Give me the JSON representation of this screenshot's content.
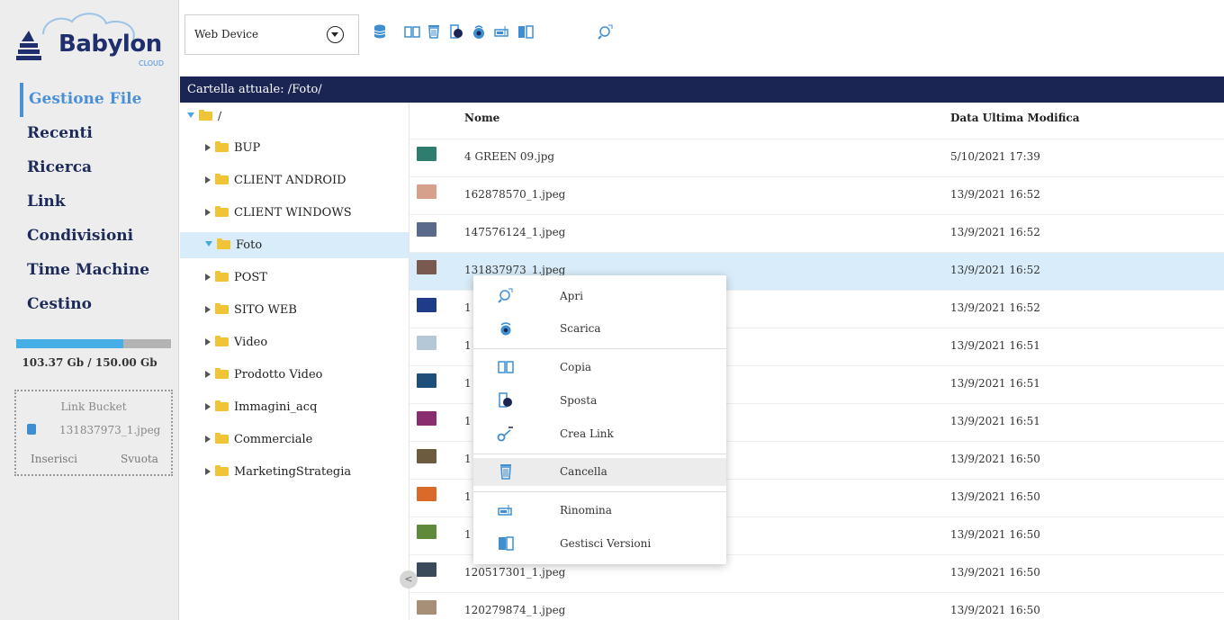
{
  "logo": {
    "name": "Babylon",
    "sub": "CLOUD"
  },
  "nav": [
    "Gestione File",
    "Recenti",
    "Ricerca",
    "Link",
    "Condivisioni",
    "Time Machine",
    "Cestino"
  ],
  "storage": {
    "used_fraction": 0.689,
    "label": "103.37 Gb / 150.00 Gb",
    "colors": {
      "fill": "#46aee6",
      "track": "#b3b3b3"
    }
  },
  "link_bucket": {
    "title": "Link Bucket",
    "file": "131837973_1.jpeg",
    "insert": "Inserisci",
    "empty": "Svuota"
  },
  "toolbar": {
    "device": "Web Device",
    "icons": [
      "database-icon",
      "copy-icon",
      "delete-icon",
      "move-icon",
      "download-icon",
      "rename-icon",
      "versions-icon",
      "open-icon"
    ]
  },
  "path": {
    "label": "Cartella attuale: /Foto/"
  },
  "tree": {
    "root": "/",
    "folders": [
      "BUP",
      "CLIENT ANDROID",
      "CLIENT WINDOWS",
      "Foto",
      "POST",
      "SITO WEB",
      "Video",
      "Prodotto Video",
      "Immagini_acq",
      "Commerciale",
      "MarketingStrategia"
    ],
    "selected": "Foto"
  },
  "files": {
    "headers": {
      "name": "Nome",
      "date": "Data Ultima Modifica"
    },
    "rows": [
      {
        "name": "4 GREEN 09.jpg",
        "date": "5/10/2021 17:39",
        "thumb": "#2f7d6e"
      },
      {
        "name": "162878570_1.jpeg",
        "date": "13/9/2021 16:52",
        "thumb": "#d6a08a"
      },
      {
        "name": "147576124_1.jpeg",
        "date": "13/9/2021 16:52",
        "thumb": "#5b6a8a"
      },
      {
        "name": "131837973_1.jpeg",
        "date": "13/9/2021 16:52",
        "thumb": "#7a5a4e"
      },
      {
        "name": "1",
        "date": "13/9/2021 16:52",
        "thumb": "#1f3c8a"
      },
      {
        "name": "1",
        "date": "13/9/2021 16:51",
        "thumb": "#b5c8d8"
      },
      {
        "name": "1",
        "date": "13/9/2021 16:51",
        "thumb": "#1d4f7a"
      },
      {
        "name": "1",
        "date": "13/9/2021 16:51",
        "thumb": "#8a2d6e"
      },
      {
        "name": "1",
        "date": "13/9/2021 16:50",
        "thumb": "#6e5a3e"
      },
      {
        "name": "1",
        "date": "13/9/2021 16:50",
        "thumb": "#d96a2a"
      },
      {
        "name": "1",
        "date": "13/9/2021 16:50",
        "thumb": "#5f8a3c"
      },
      {
        "name": "120517301_1.jpeg",
        "date": "13/9/2021 16:50",
        "thumb": "#3a4a5a"
      },
      {
        "name": "120279874_1.jpeg",
        "date": "13/9/2021 16:50",
        "thumb": "#a78f77"
      }
    ],
    "selected_index": 3
  },
  "context_menu": {
    "items": [
      {
        "label": "Apri",
        "icon": "search-icon"
      },
      {
        "label": "Scarica",
        "icon": "download-icon"
      },
      {
        "label": "Copia",
        "icon": "copy-icon"
      },
      {
        "label": "Sposta",
        "icon": "move-icon"
      },
      {
        "label": "Crea Link",
        "icon": "link-icon"
      },
      {
        "label": "Cancella",
        "icon": "trash-icon"
      },
      {
        "label": "Rinomina",
        "icon": "rename-icon"
      },
      {
        "label": "Gestisci Versioni",
        "icon": "versions-icon"
      }
    ],
    "hovered": "Cancella"
  },
  "accent": "#4a90d9",
  "header_bar_color": "#1a2553"
}
